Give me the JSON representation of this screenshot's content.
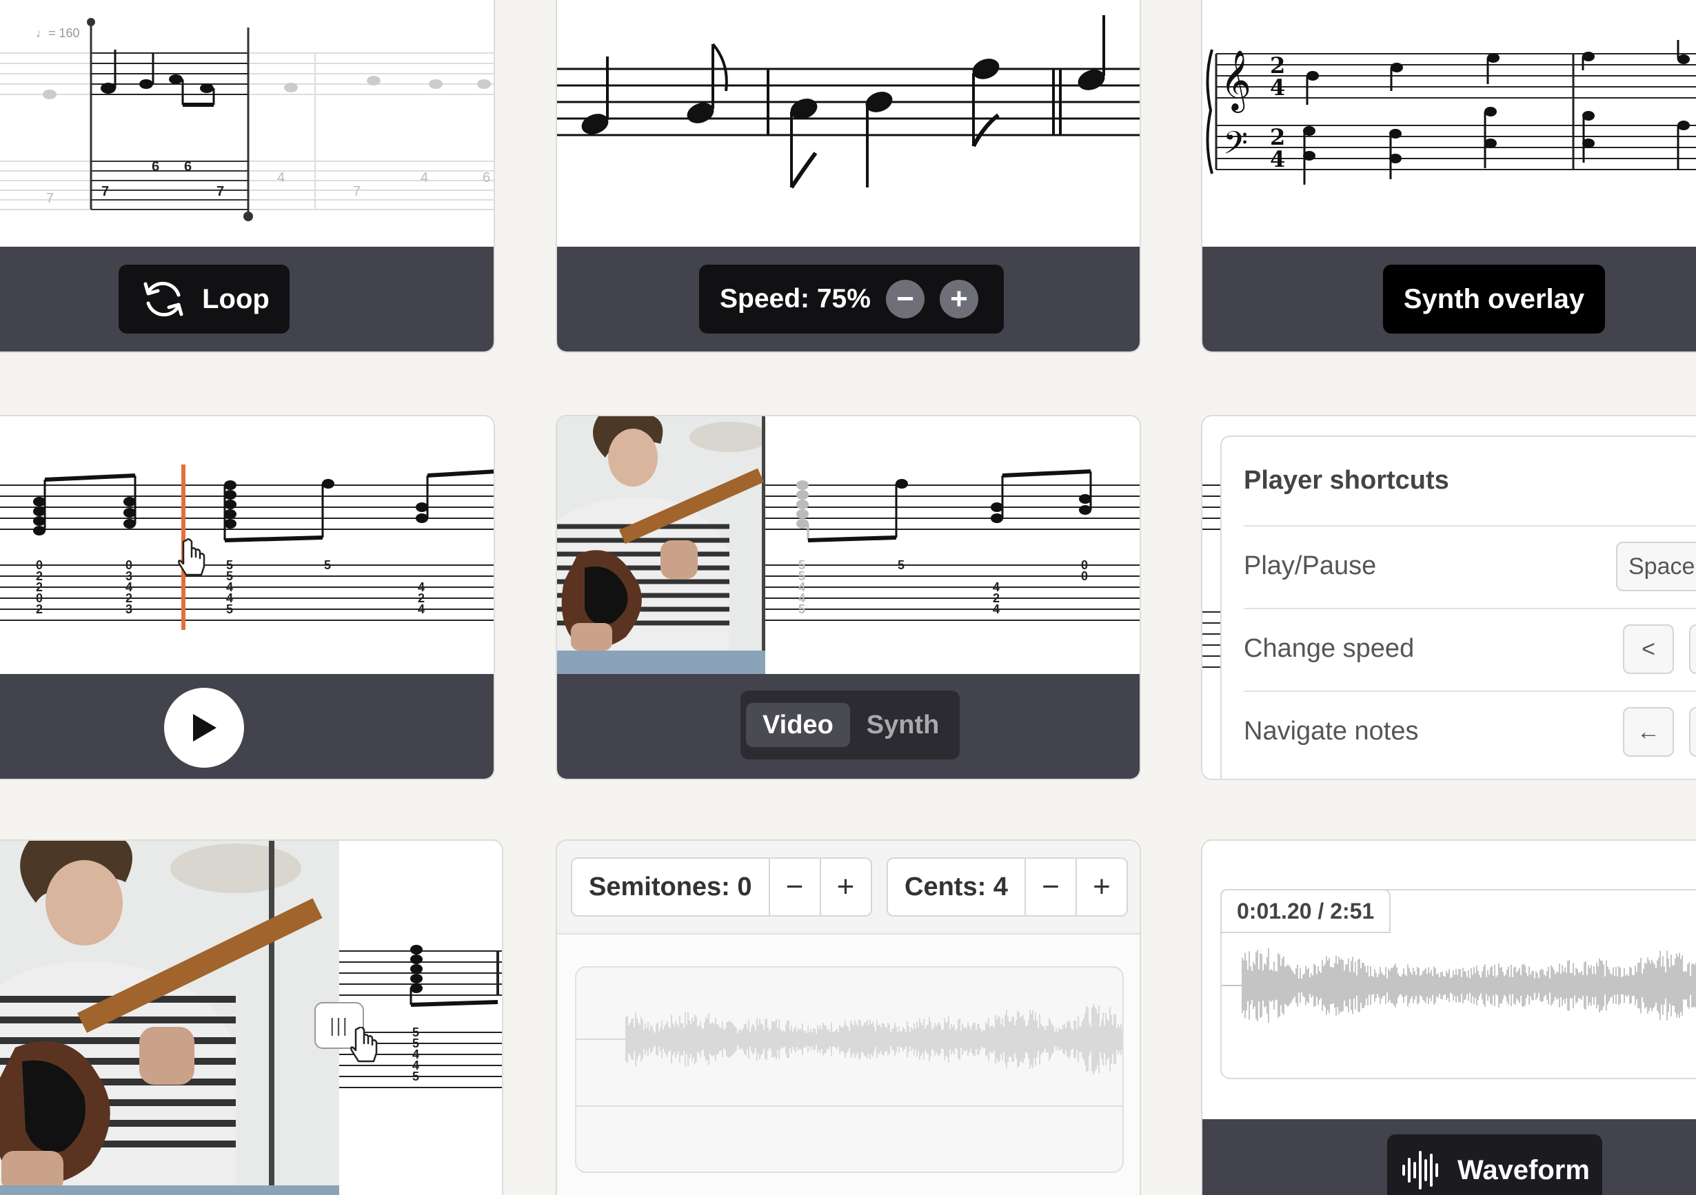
{
  "loop_card": {
    "button_label": "Loop",
    "tempo_marking": "♩= 160",
    "tab_numbers": [
      "7",
      "6",
      "6",
      "7",
      "4",
      "7",
      "4",
      "6",
      "7"
    ]
  },
  "speed_card": {
    "speed_label": "Speed: 75%",
    "speed_percent": 75,
    "minus_symbol": "−",
    "plus_symbol": "+"
  },
  "synth_card": {
    "button_label": "Synth overlay"
  },
  "playhead_card": {
    "tab_col1": [
      "0",
      "2",
      "2",
      "0",
      "2"
    ],
    "tab_col2": [
      "0",
      "3",
      "4",
      "2",
      "3"
    ],
    "tab_col3": [
      "5",
      "5",
      "4",
      "4",
      "5"
    ],
    "tab_single": "5",
    "tab_col4": [
      "4",
      "2",
      "4"
    ]
  },
  "video_card": {
    "tabs": [
      {
        "label": "Video",
        "active": true
      },
      {
        "label": "Synth",
        "active": false
      }
    ],
    "tab_col1": [
      "5",
      "5",
      "4",
      "4",
      "5"
    ],
    "tab_single": "5",
    "tab_col2": [
      "4",
      "2",
      "4"
    ],
    "tab_col3": [
      "0",
      "0"
    ]
  },
  "shortcuts_card": {
    "title": "Player shortcuts",
    "rows": [
      {
        "label": "Play/Pause",
        "key": "Space"
      },
      {
        "label": "Change speed",
        "key": "<"
      },
      {
        "label": "Navigate notes",
        "key": "←"
      }
    ]
  },
  "split_card": {
    "handle_symbol": "|||",
    "tab_col": [
      "5",
      "5",
      "4",
      "4",
      "5"
    ]
  },
  "pitch_card": {
    "semitones_label": "Semitones: 0",
    "cents_label": "Cents: 4",
    "minus_symbol": "−",
    "plus_symbol": "+"
  },
  "waveform_card": {
    "time_label": "0:01.20 / 2:51",
    "button_label": "Waveform"
  },
  "colors": {
    "background": "#f5f4f1",
    "bar": "#43434d",
    "pill": "#111114",
    "playhead": "#e2703a"
  }
}
